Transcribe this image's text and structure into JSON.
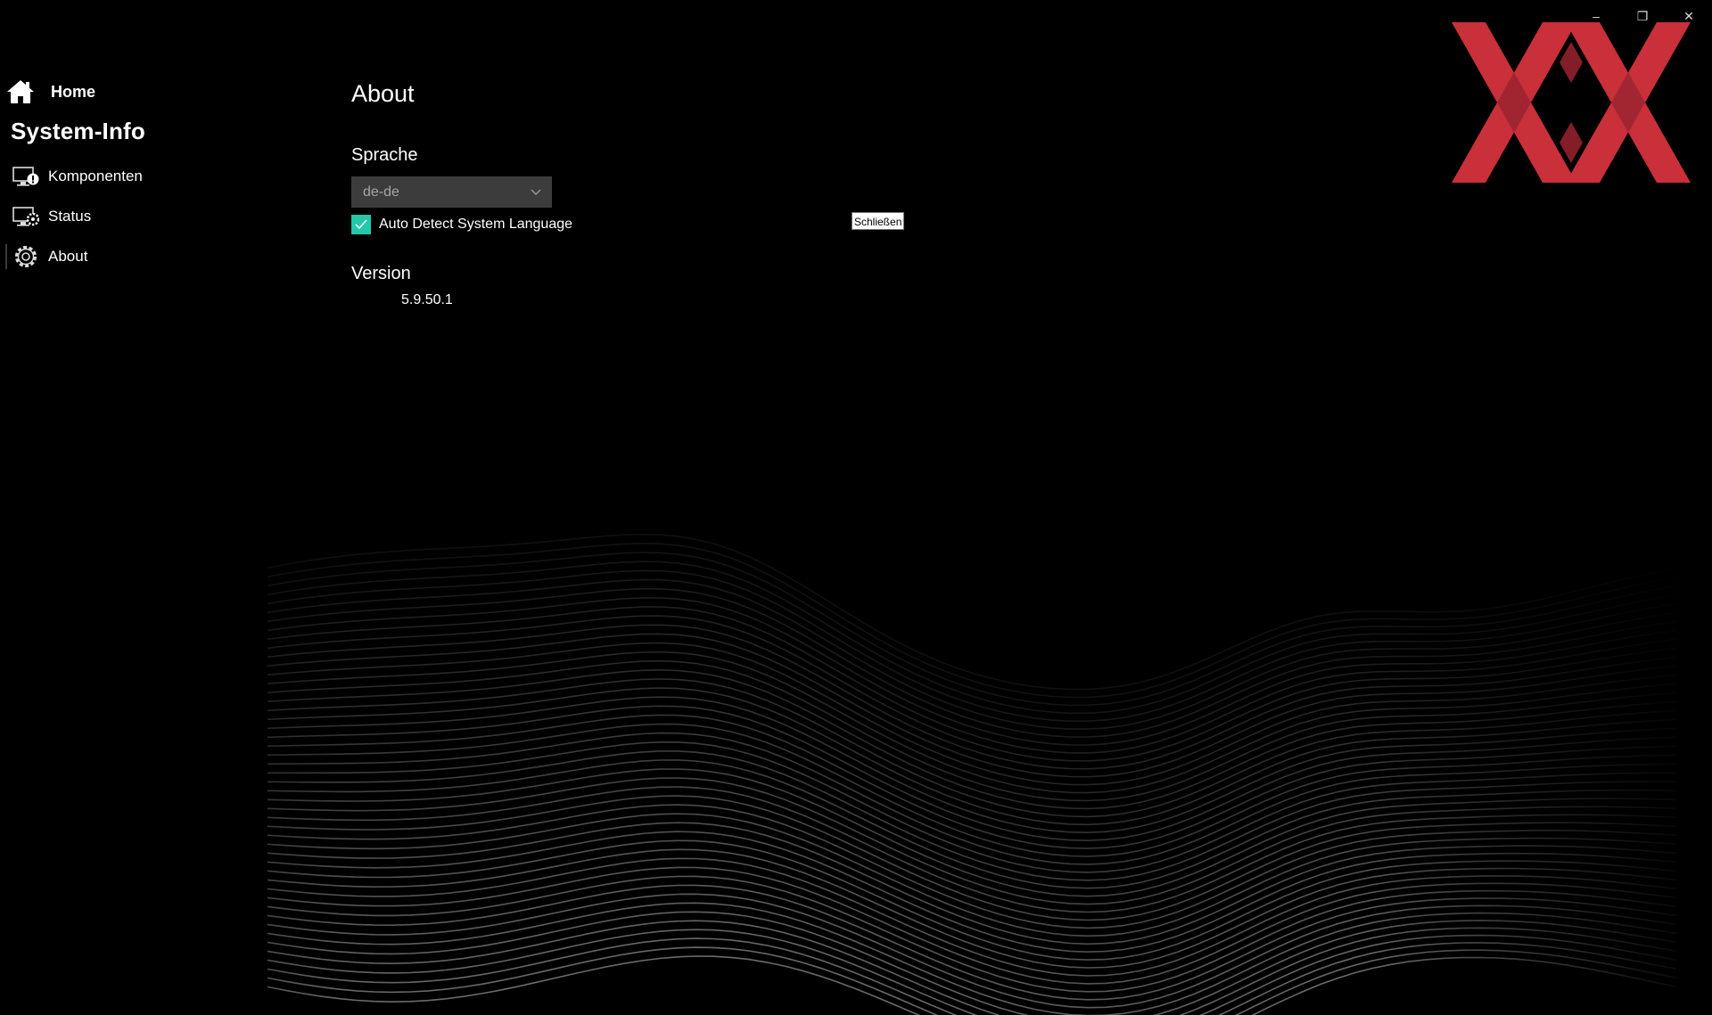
{
  "window": {
    "controls": {
      "minimize": "–",
      "restore": "❐",
      "close": "✕"
    }
  },
  "sidebar": {
    "home_label": "Home",
    "section_title": "System-Info",
    "items": [
      {
        "label": "Komponenten",
        "icon": "monitor-info-icon"
      },
      {
        "label": "Status",
        "icon": "monitor-gear-icon"
      },
      {
        "label": "About",
        "icon": "gear-icon",
        "selected": true
      }
    ]
  },
  "main": {
    "title": "About",
    "language": {
      "label": "Sprache",
      "dropdown_value": "de-de",
      "auto_detect_label": "Auto Detect System Language",
      "auto_detect_checked": true
    },
    "version": {
      "label": "Version",
      "value": "5.9.50.1"
    },
    "close_button_label": "Schließen"
  },
  "colors": {
    "background": "#000000",
    "accent_checkbox": "#21c9a9",
    "dropdown_bg": "#3c3c3c",
    "logo_red": "#c9303a"
  }
}
